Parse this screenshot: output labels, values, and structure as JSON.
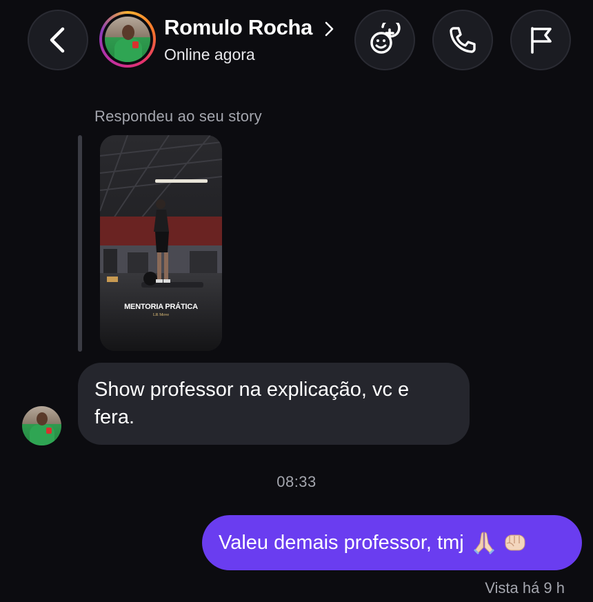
{
  "header": {
    "contact_name": "Romulo Rocha",
    "status": "Online agora",
    "icons": {
      "back": "back-chevron-icon",
      "effects": "stickers-effects-icon",
      "call": "phone-icon",
      "report": "flag-icon"
    }
  },
  "story_reply": {
    "caption": "Respondeu ao seu story",
    "story_title": "MENTORIA PRÁTICA",
    "story_subtitle": "LR Move"
  },
  "messages": [
    {
      "direction": "incoming",
      "text": "Show professor na explicação, vc e fera."
    },
    {
      "direction": "outgoing",
      "text": "Valeu demais professor, tmj",
      "emoji": [
        "praying-hands",
        "fist-bump"
      ]
    }
  ],
  "time_divider": "08:33",
  "seen_status": "Vista há 9 h",
  "colors": {
    "background": "#0c0c10",
    "incoming_bubble": "#25262d",
    "outgoing_bubble": "#6a3df0",
    "muted_text": "#a4a6ae"
  }
}
